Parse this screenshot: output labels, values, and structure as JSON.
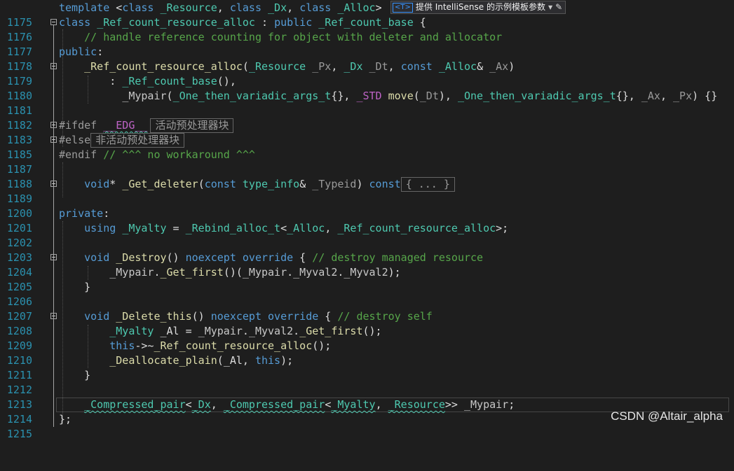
{
  "lines": [
    {
      "n": "1175"
    },
    {
      "n": "1176"
    },
    {
      "n": "1177"
    },
    {
      "n": "1178"
    },
    {
      "n": "1179"
    },
    {
      "n": "1180"
    },
    {
      "n": "1181"
    },
    {
      "n": "1182"
    },
    {
      "n": "1183"
    },
    {
      "n": "1185"
    },
    {
      "n": "1187"
    },
    {
      "n": "1188"
    },
    {
      "n": "1189"
    },
    {
      "n": "1200"
    },
    {
      "n": "1201"
    },
    {
      "n": "1202"
    },
    {
      "n": "1203"
    },
    {
      "n": "1204"
    },
    {
      "n": "1205"
    },
    {
      "n": "1206"
    },
    {
      "n": "1207"
    },
    {
      "n": "1208"
    },
    {
      "n": "1209"
    },
    {
      "n": "1210"
    },
    {
      "n": "1211"
    },
    {
      "n": "1212"
    },
    {
      "n": "1213"
    },
    {
      "n": "1214"
    },
    {
      "n": "1215"
    }
  ],
  "hint": {
    "badge": "<T>",
    "text": "提供 IntelliSense 的示例模板参数"
  },
  "regions": {
    "active": "活动预处理器块",
    "inactive": "非活动预处理器块",
    "collapsed": "{ ... }"
  },
  "watermark": "CSDN @Altair_alpha"
}
